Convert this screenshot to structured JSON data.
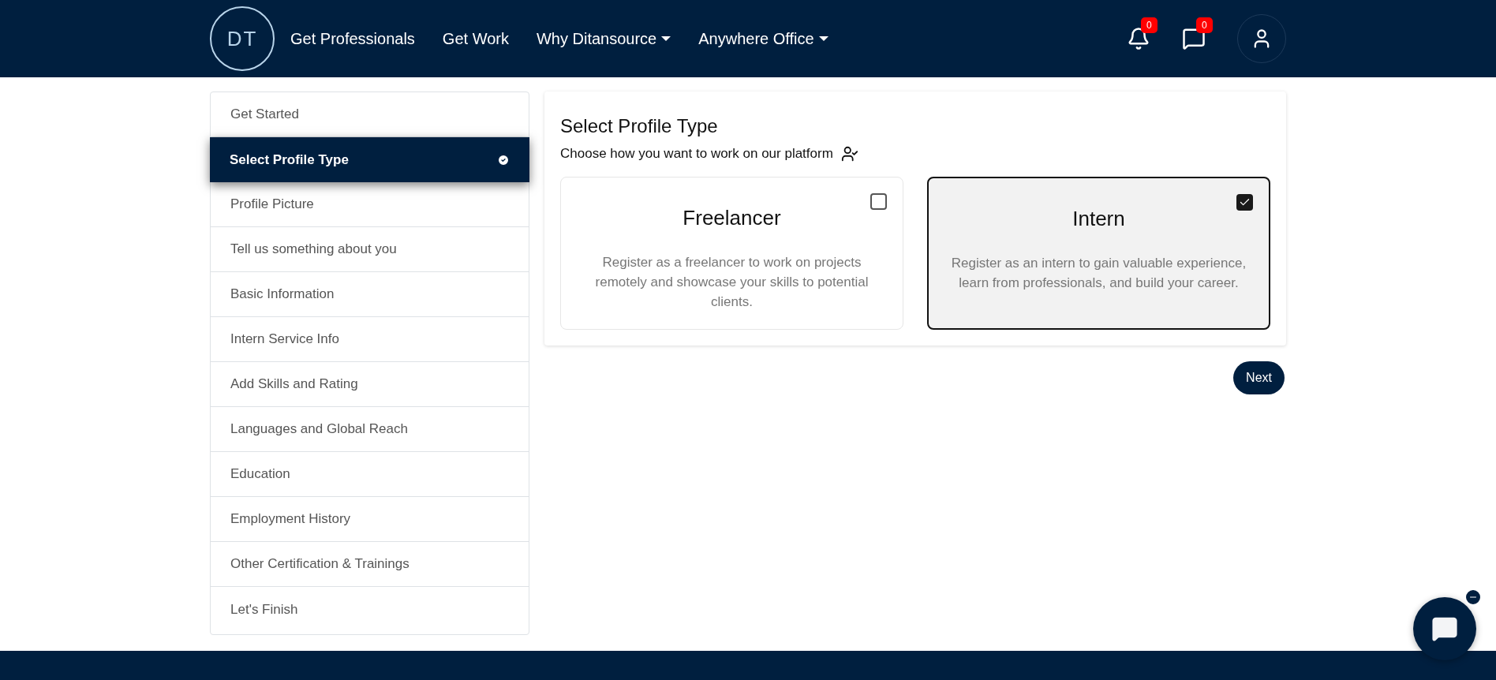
{
  "header": {
    "logo": "DT",
    "nav": [
      {
        "label": "Get Professionals",
        "dropdown": false
      },
      {
        "label": "Get Work",
        "dropdown": false
      },
      {
        "label": "Why Ditansource",
        "dropdown": true
      },
      {
        "label": "Anywhere Office",
        "dropdown": true
      }
    ],
    "notifications": "0",
    "messages": "0"
  },
  "sidebar": {
    "items": [
      {
        "label": "Get Started",
        "selected": false,
        "done": false
      },
      {
        "label": "Select Profile Type",
        "selected": true,
        "done": true
      },
      {
        "label": "Profile Picture",
        "selected": false,
        "done": false
      },
      {
        "label": "Tell us something about you",
        "selected": false,
        "done": false
      },
      {
        "label": "Basic Information",
        "selected": false,
        "done": false
      },
      {
        "label": "Intern Service Info",
        "selected": false,
        "done": false
      },
      {
        "label": "Add Skills and Rating",
        "selected": false,
        "done": false
      },
      {
        "label": "Languages and Global Reach",
        "selected": false,
        "done": false
      },
      {
        "label": "Education",
        "selected": false,
        "done": false
      },
      {
        "label": "Employment History",
        "selected": false,
        "done": false
      },
      {
        "label": "Other Certification & Trainings",
        "selected": false,
        "done": false
      },
      {
        "label": "Let's Finish",
        "selected": false,
        "done": false
      }
    ]
  },
  "main": {
    "title": "Select Profile Type",
    "subtitle": "Choose how you want to work on our platform",
    "options": [
      {
        "title": "Freelancer",
        "description": "Register as a freelancer to work on projects remotely and showcase your skills to potential clients.",
        "selected": false
      },
      {
        "title": "Intern",
        "description": "Register as an intern to gain valuable experience, learn from professionals, and build your career.",
        "selected": true
      }
    ],
    "next_button": "Next"
  }
}
